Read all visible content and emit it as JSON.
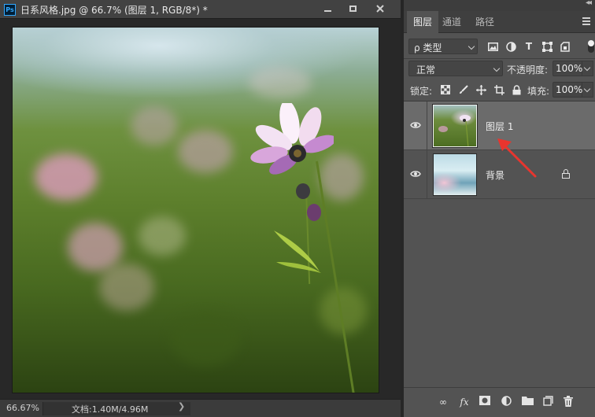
{
  "document": {
    "title": "日系风格.jpg @ 66.7% (图层 1, RGB/8*) *",
    "app_badge": "Ps",
    "zoom": "66.67%",
    "doc_info": "文档:1.40M/4.96M",
    "status_arrow": "❯"
  },
  "panel": {
    "tabs": [
      "图层",
      "通道",
      "路径"
    ],
    "active_tab": "图层",
    "filter": {
      "kind_label": "ρ 类型",
      "icons": [
        "image-filter-icon",
        "adjustment-filter-icon",
        "type-filter-icon",
        "shape-filter-icon",
        "smart-object-filter-icon"
      ],
      "type_glyph": "T"
    },
    "blend_mode": "正常",
    "opacity_label": "不透明度:",
    "opacity_value": "100%",
    "lock_label": "锁定:",
    "fill_label": "填充:",
    "fill_value": "100%",
    "layers": [
      {
        "name": "图层 1",
        "visible": true,
        "selected": true,
        "locked": false
      },
      {
        "name": "背景",
        "visible": true,
        "selected": false,
        "locked": true
      }
    ],
    "footer": {
      "link": "∞",
      "fx": "fx"
    }
  },
  "colors": {
    "annotation_arrow": "#e8352e",
    "panel_bg": "#535353",
    "selected_layer": "#6b6b6b"
  }
}
